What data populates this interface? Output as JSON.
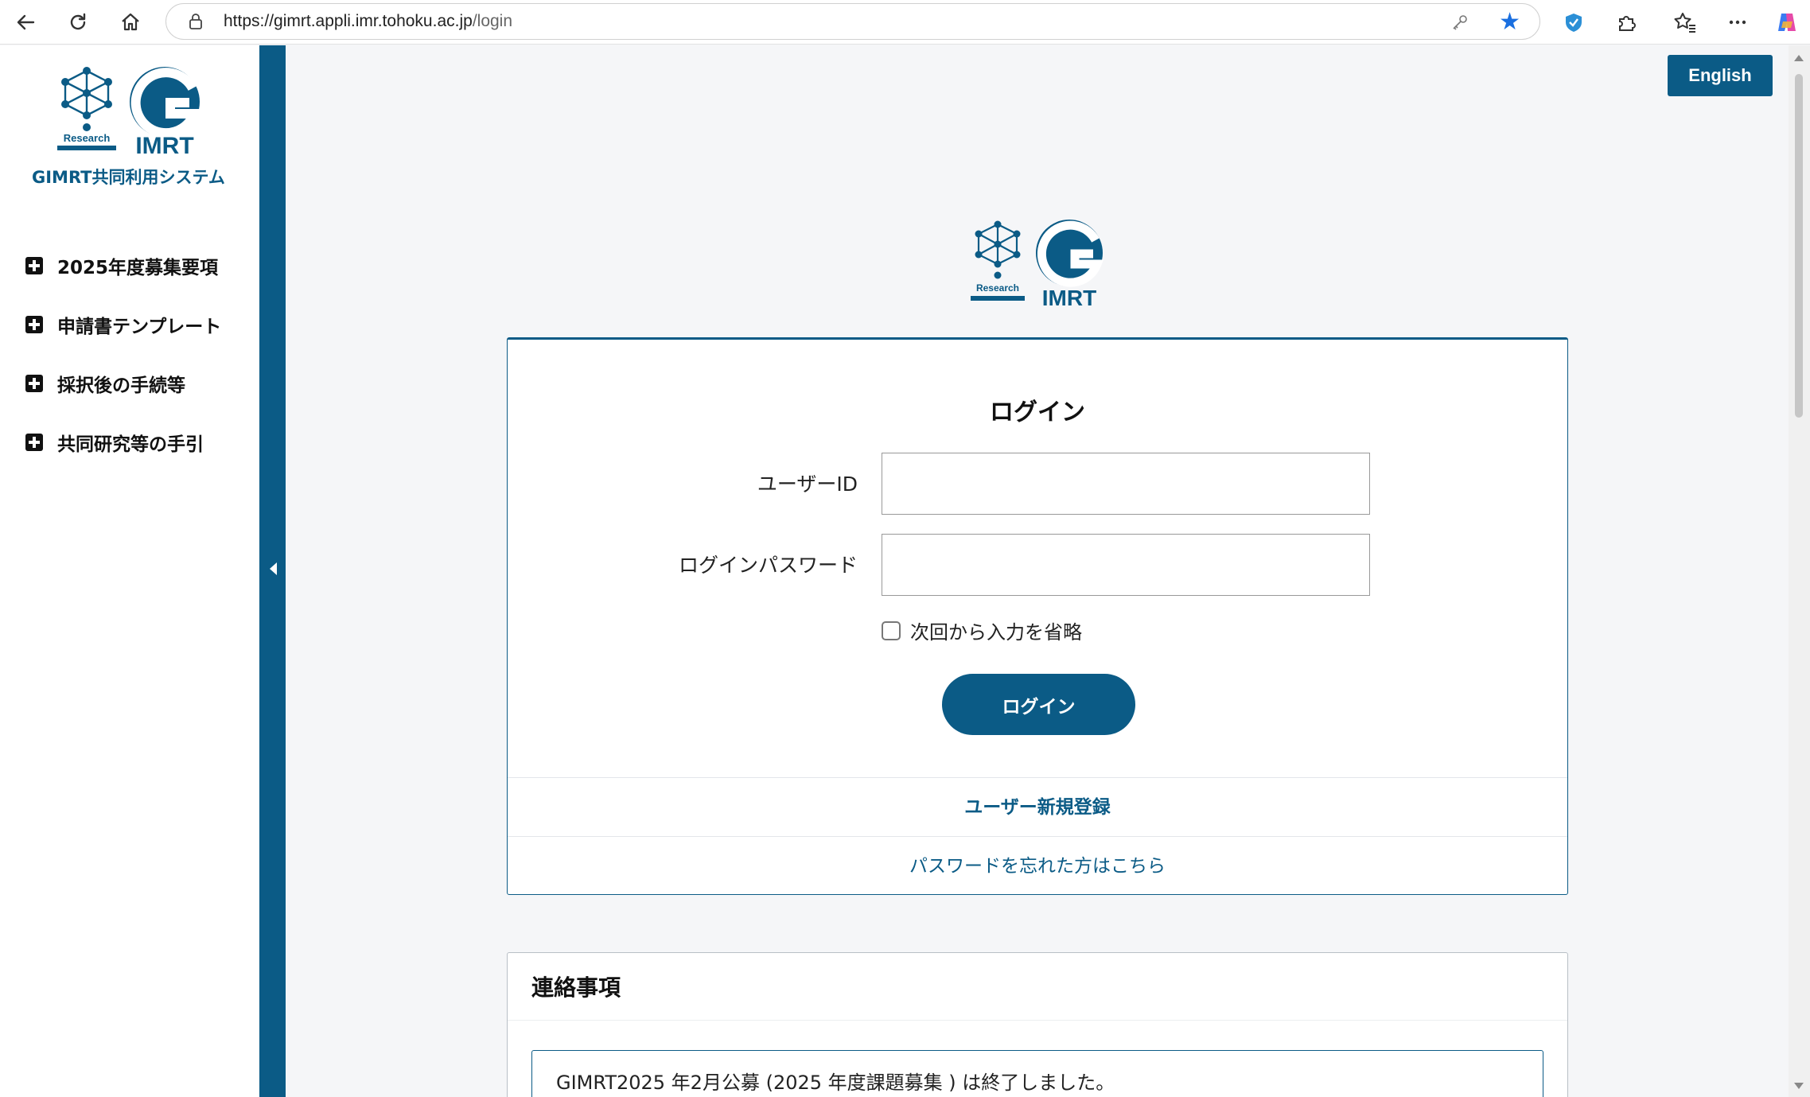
{
  "browser": {
    "url_host": "https://gimrt.appli.imr.tohoku.ac.jp",
    "url_path": "/login",
    "icons": [
      "back-icon",
      "reload-icon",
      "home-icon",
      "lock-icon",
      "key-icon",
      "star-icon",
      "shield-extension-icon",
      "puzzle-icon",
      "favorites-icon",
      "more-icon",
      "copilot-icon"
    ]
  },
  "sidebar": {
    "logo_text_research": "Research",
    "logo_text_imrt": "IMRT",
    "system_title": "GIMRT共同利用システム",
    "items": [
      {
        "label": "2025年度募集要項"
      },
      {
        "label": "申請書テンプレート"
      },
      {
        "label": "採択後の手続等"
      },
      {
        "label": "共同研究等の手引"
      }
    ]
  },
  "header": {
    "lang_button": "English"
  },
  "login": {
    "title": "ログイン",
    "user_id_label": "ユーザーID",
    "user_id_value": "",
    "password_label": "ログインパスワード",
    "password_value": "",
    "remember_label": "次回から入力を省略",
    "remember_checked": false,
    "submit_label": "ログイン",
    "register_link": "ユーザー新規登録",
    "forgot_link": "パスワードを忘れた方はこちら"
  },
  "notices": {
    "heading": "連絡事項",
    "items": [
      {
        "text": "GIMRT2025 年2月公募 (2025 年度課題募集 ) は終了しました。"
      }
    ]
  },
  "colors": {
    "brand": "#0b5b86",
    "background": "#f5f6f8",
    "accent_star": "#1a6fe0"
  }
}
